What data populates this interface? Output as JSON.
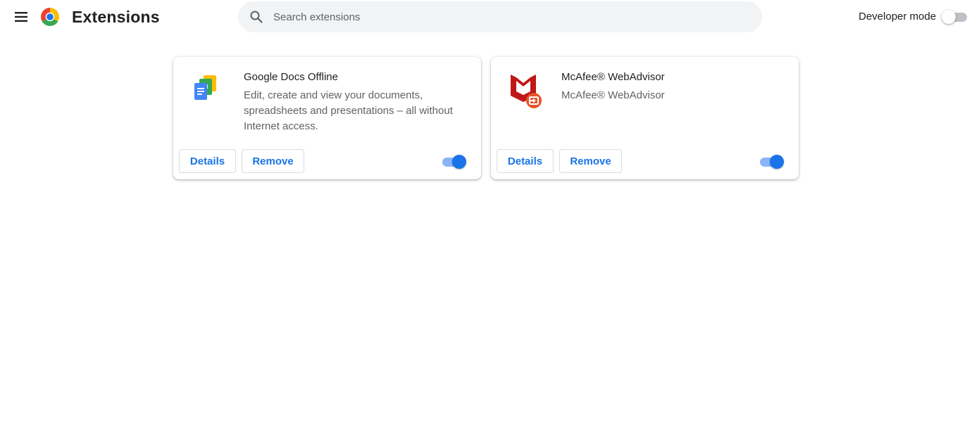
{
  "header": {
    "title": "Extensions",
    "menu_icon": "hamburger-menu-icon",
    "logo_icon": "chrome-logo-icon"
  },
  "search": {
    "placeholder": "Search extensions",
    "value": "",
    "icon": "search-icon"
  },
  "developer_mode": {
    "label": "Developer mode",
    "enabled": false
  },
  "extensions": [
    {
      "name": "Google Docs Offline",
      "description": "Edit, create and view your documents, spreadsheets and presentations – all without Internet access.",
      "icon": "google-docs-offline-icon",
      "details_label": "Details",
      "remove_label": "Remove",
      "enabled": true
    },
    {
      "name": "McAfee® WebAdvisor",
      "description": "McAfee® WebAdvisor",
      "icon": "mcafee-webadvisor-icon",
      "details_label": "Details",
      "remove_label": "Remove",
      "enabled": true
    }
  ],
  "colors": {
    "accent": "#1a73e8",
    "toggle_track_on": "#8ab4f8",
    "toggle_track_off": "#bdc1c6",
    "search_bg": "#f1f3f4",
    "mcafee_red": "#c01818"
  }
}
